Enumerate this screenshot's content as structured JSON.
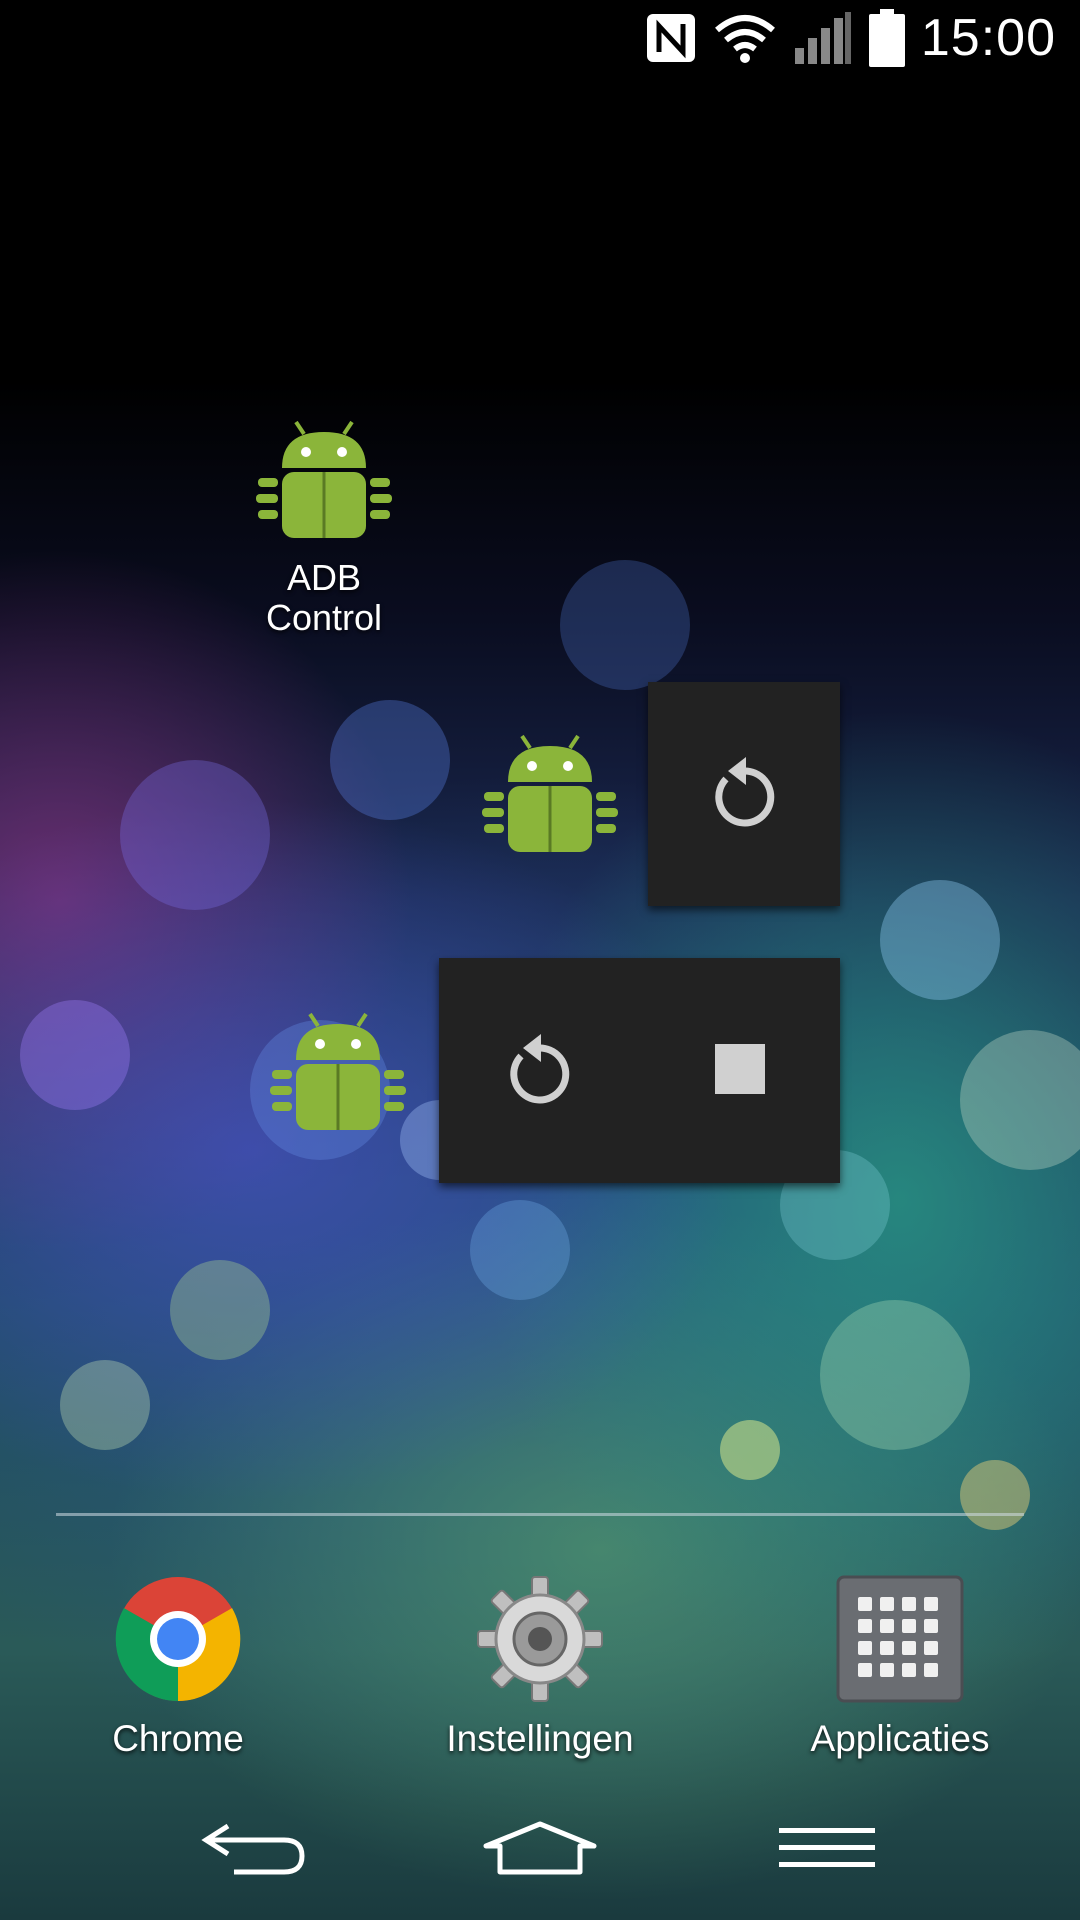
{
  "status_bar": {
    "time": "15:00",
    "icons": [
      "nfc-icon",
      "wifi-icon",
      "signal-icon",
      "battery-icon"
    ]
  },
  "home": {
    "adb_shortcut": {
      "label": "ADB\nControl",
      "label_line1": "ADB",
      "label_line2": "Control",
      "icon": "adb-bug-icon"
    },
    "widget_small": {
      "icon": "adb-bug-icon",
      "buttons": [
        "restart-icon"
      ]
    },
    "widget_large": {
      "icon": "adb-bug-icon",
      "buttons": [
        "restart-icon",
        "stop-icon"
      ]
    }
  },
  "dock": {
    "items": [
      {
        "label": "Chrome",
        "icon": "chrome-icon"
      },
      {
        "label": "Instellingen",
        "icon": "settings-gear-icon"
      },
      {
        "label": "Applicaties",
        "icon": "app-drawer-icon"
      }
    ]
  },
  "nav_bar": {
    "buttons": [
      "back-icon",
      "home-icon",
      "menu-icon"
    ]
  },
  "colors": {
    "widget_bg": "#222222",
    "bug_green": "#8bb53a",
    "icon_grey": "#d0d0d0"
  }
}
